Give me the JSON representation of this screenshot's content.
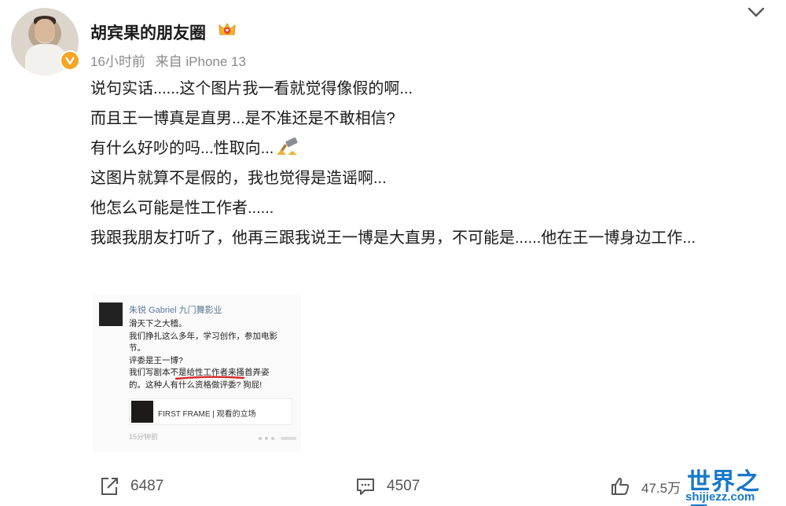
{
  "header": {
    "username": "胡宾果的朋友圈",
    "time": "16小时前",
    "source": "来自 iPhone 13",
    "menu_icon": "chevron-down-icon",
    "badge_icon": "verified-v-icon",
    "member_icon": "crown-badge-icon"
  },
  "post": {
    "lines": [
      "说句实话......这个图片我一看就觉得像假的啊...",
      "而且王一博真是直男...是不准还是不敢相信?",
      "有什么好吵的吗...性取向...",
      "这图片就算不是假的，我也觉得是造谣啊...",
      "他怎么可能是性工作者......",
      "我跟我朋友打听了，他再三跟我说王一博是大直男，不可能是......他在王一博身边工作..."
    ],
    "inline_emoji": "hammer-emoji-icon"
  },
  "embedded_image": {
    "author": "朱锐 Gabriel 九门舞影业",
    "text_lines": [
      "滑天下之大稽。",
      "我们挣扎这么多年，学习创作，参加电影",
      "节。",
      "评委是王一博?",
      "我们写剧本不是给性工作者来搔首弄姿",
      "的。这种人有什么资格做评委? 狗屁!"
    ],
    "card_title": "FIRST FRAME | 观看的立场",
    "time": "15分钟前"
  },
  "actions": {
    "share_count": "6487",
    "comment_count": "4507",
    "like_count": "47.5万"
  },
  "watermark": {
    "cn": "世界之最",
    "en": "shijiezz.com"
  },
  "colors": {
    "verified": "#f5a623",
    "link_blue": "#5d7a9c",
    "watermark": "#1778c9"
  }
}
